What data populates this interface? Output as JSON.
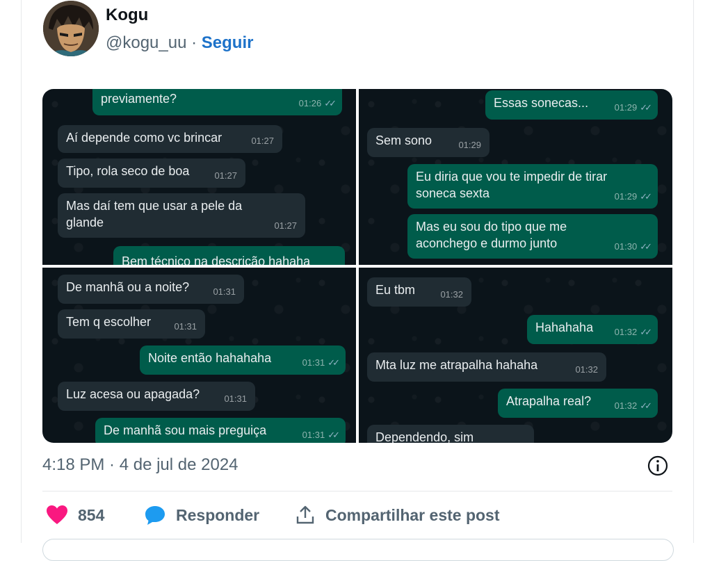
{
  "tweet": {
    "author": "Kogu",
    "handle": "@kogu_uu",
    "separator": " · ",
    "follow_label": "Seguir",
    "timestamp": "4:18 PM · 4 de jul de 2024",
    "likes": "854",
    "reply_label": "Responder",
    "share_label": "Compartilhar este post",
    "like_color": "#f91880",
    "reply_color": "#1d9bf0"
  },
  "chat": {
    "bubble_in_color": "#202c33",
    "bubble_out_color": "#005c4b",
    "background_color": "#0b141a",
    "panels": [
      {
        "messages": [
          {
            "dir": "out",
            "text": "previamente?",
            "time": "01:26"
          },
          {
            "dir": "in",
            "text": "Aí depende como vc brincar",
            "time": "01:27"
          },
          {
            "dir": "in",
            "text": "Tipo, rola seco de boa",
            "time": "01:27"
          },
          {
            "dir": "in",
            "text": "Mas daí tem que usar a pele da\nglande",
            "time": "01:27"
          },
          {
            "dir": "out",
            "text": "Bem técnico na descrição hahaha",
            "time": ""
          }
        ]
      },
      {
        "messages": [
          {
            "dir": "out",
            "text": "Essas sonecas...",
            "time": "01:29"
          },
          {
            "dir": "in",
            "text": "Sem sono",
            "time": "01:29"
          },
          {
            "dir": "out",
            "text": "Eu diria que vou te impedir de tirar\nsoneca sexta",
            "time": "01:29"
          },
          {
            "dir": "out",
            "text": "Mas eu sou do tipo que me\naconchego e durmo junto",
            "time": "01:30"
          }
        ]
      },
      {
        "messages": [
          {
            "dir": "in",
            "text": "De manhã ou a noite?",
            "time": "01:31"
          },
          {
            "dir": "in",
            "text": "Tem q escolher",
            "time": "01:31"
          },
          {
            "dir": "out",
            "text": "Noite então hahahaha",
            "time": "01:31"
          },
          {
            "dir": "in",
            "text": "Luz acesa ou apagada?",
            "time": "01:31"
          },
          {
            "dir": "out",
            "text": "De manhã sou mais preguiça",
            "time": "01:31"
          }
        ]
      },
      {
        "messages": [
          {
            "dir": "in",
            "text": "Eu tbm",
            "time": "01:32"
          },
          {
            "dir": "out",
            "text": "Hahahaha",
            "time": "01:32"
          },
          {
            "dir": "in",
            "text": "Mta luz me atrapalha hahaha",
            "time": "01:32"
          },
          {
            "dir": "out",
            "text": "Atrapalha real?",
            "time": "01:32"
          },
          {
            "dir": "in",
            "text": "Dependendo, sim",
            "time": ""
          }
        ]
      }
    ]
  }
}
